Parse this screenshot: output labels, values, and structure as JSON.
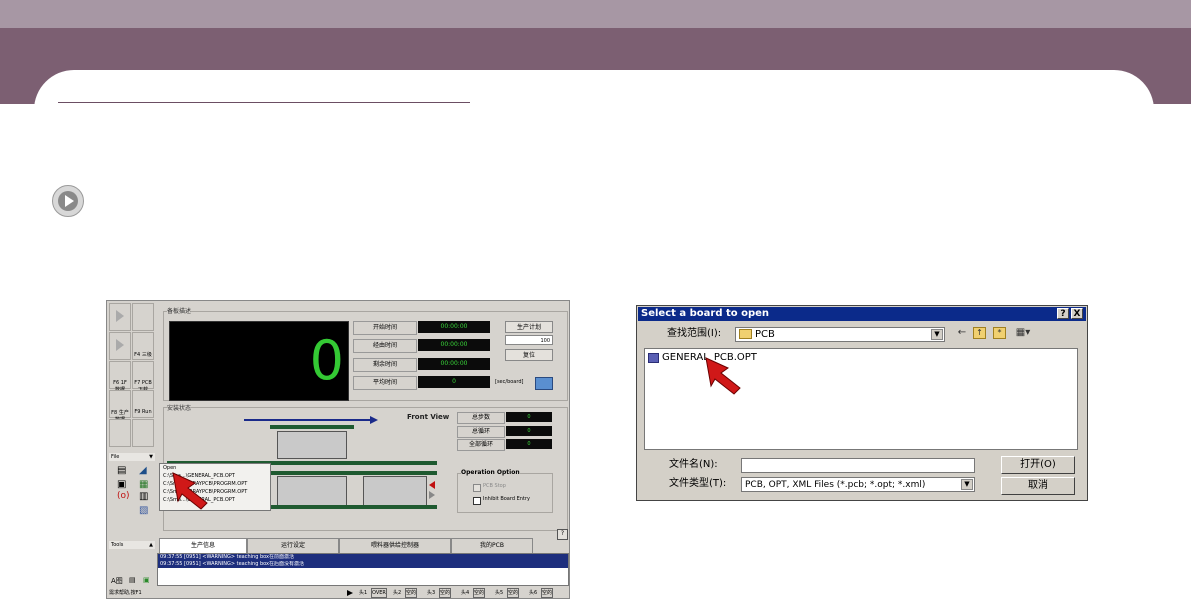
{
  "shot1": {
    "left_buttons": [
      "",
      "",
      "",
      "F4 三级",
      "F6 1F 数据",
      "F7 PCB下载",
      "F8 生产数据",
      "F9 Run",
      "",
      ""
    ],
    "file_label": "File",
    "tools_label": "Tools",
    "panel_title": "备板描述",
    "big_value": "0",
    "time_rows": [
      {
        "label": "开始时间",
        "value": "00:00:00"
      },
      {
        "label": "经由时间",
        "value": "00:00:00"
      },
      {
        "label": "剩余时间",
        "value": "00:00:00"
      },
      {
        "label": "平均时间",
        "value": "0"
      }
    ],
    "unit_label": "[sec/board]",
    "plan_button": "生产计划",
    "plan_value": "100",
    "reset_button": "复位",
    "status_panel_title": "安装状态",
    "front_view": "Front View",
    "stat_rows": [
      {
        "label": "总步数",
        "value": "0"
      },
      {
        "label": "总循环",
        "value": "0"
      },
      {
        "label": "全部循环",
        "value": "0"
      }
    ],
    "operation_title": "Operation Option",
    "pcb_stop": "PCB Stop",
    "inhibit": "Inhibit Board Entry",
    "context_menu": [
      "Open",
      "C:\\Sma...\\GENERAL_PCB.OPT",
      "C:\\Sma...ARRAYPCB\\PROGRM.OPT",
      "C:\\Sma...ARRAYPCB\\PROGRM.OPT",
      "C:\\Sma...\\GENERAL_PCB.OPT"
    ],
    "tabs": [
      "生产信息",
      "运行设定",
      "喂料器供给控制器",
      "我的PCB"
    ],
    "log_lines": [
      "09:37:55 [0951] <WARNING> teaching box在前面激活",
      "09:37:55 [0951] <WARNING> teaching box在后面没有激活"
    ],
    "status_left": "需求帮助,按F1",
    "status_right": [
      "头1",
      "OVER",
      "头2",
      "空的",
      "头3",
      "空的",
      "头4",
      "空的",
      "头5",
      "空的",
      "头6",
      "空的"
    ],
    "help_button": "?"
  },
  "dialog": {
    "title": "Select a board to open",
    "help_btn": "?",
    "close_btn": "X",
    "lookin_label": "查找范围(I):",
    "lookin_value": "PCB",
    "file_item": "GENERAL_PCB.OPT",
    "filename_label": "文件名(N):",
    "filename_value": "",
    "filetype_label": "文件类型(T):",
    "filetype_value": "PCB, OPT, XML Files (*.pcb; *.opt; *.xml)",
    "open_button": "打开(O)",
    "cancel_button": "取消"
  },
  "colors": {
    "band_light": "#a797a4",
    "band_dark": "#7c5f72",
    "led_green": "#34c934",
    "dialog_title": "#0b2a8a",
    "cursor_red": "#d01818"
  }
}
